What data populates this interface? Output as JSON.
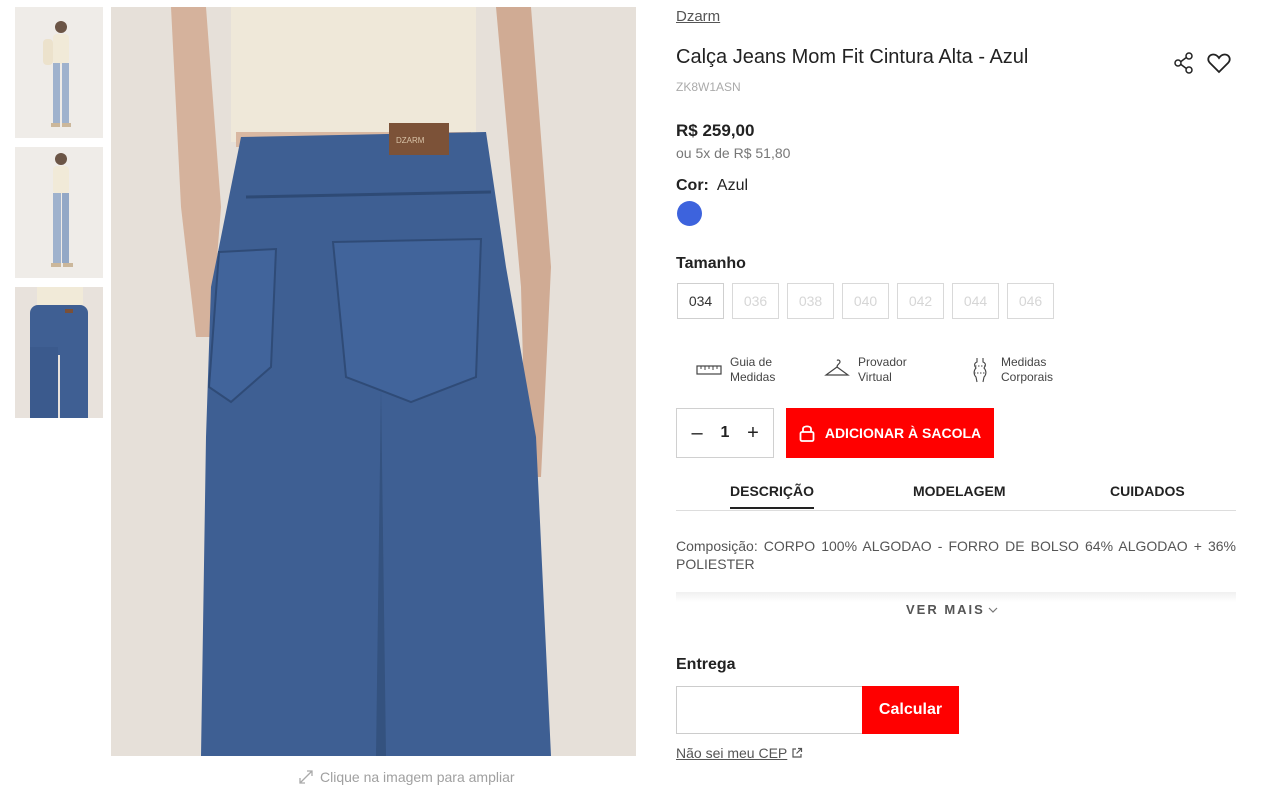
{
  "gallery": {
    "thumbnails": [
      {
        "alt": "front-full-body"
      },
      {
        "alt": "side-full-body"
      },
      {
        "alt": "back-close-up"
      }
    ],
    "zoom_hint": "Clique na imagem para ampliar"
  },
  "product": {
    "brand": "Dzarm",
    "title": "Calça Jeans Mom Fit Cintura Alta - Azul",
    "sku": "ZK8W1ASN",
    "price": "R$ 259,00",
    "installments": "ou 5x de R$ 51,80",
    "color_label": "Cor:",
    "color_value": "Azul",
    "color_swatch": "#3d63dd",
    "size_title": "Tamanho",
    "sizes": [
      {
        "label": "034",
        "available": true
      },
      {
        "label": "036",
        "available": false
      },
      {
        "label": "038",
        "available": false
      },
      {
        "label": "040",
        "available": false
      },
      {
        "label": "042",
        "available": false
      },
      {
        "label": "044",
        "available": false
      },
      {
        "label": "046",
        "available": false
      }
    ]
  },
  "tools": [
    {
      "line1": "Guia de",
      "line2": "Medidas",
      "icon": "ruler-icon"
    },
    {
      "line1": "Provador",
      "line2": "Virtual",
      "icon": "hanger-icon"
    },
    {
      "line1": "Medidas",
      "line2": "Corporais",
      "icon": "body-measure-icon"
    }
  ],
  "cart": {
    "minus": "–",
    "quantity": "1",
    "plus": "+",
    "add_label": "ADICIONAR À SACOLA",
    "accent": "#ff0000"
  },
  "tabs": [
    {
      "label": "DESCRIÇÃO",
      "active": true
    },
    {
      "label": "MODELAGEM",
      "active": false
    },
    {
      "label": "CUIDADOS",
      "active": false
    }
  ],
  "description": {
    "composition": "Composição: CORPO 100% ALGODAO - FORRO DE BOLSO 64% ALGODAO + 36% POLIESTER",
    "more_label": "VER MAIS"
  },
  "shipping": {
    "title": "Entrega",
    "cep_value": "",
    "calc_label": "Calcular",
    "no_cep_label": "Não sei meu CEP"
  }
}
